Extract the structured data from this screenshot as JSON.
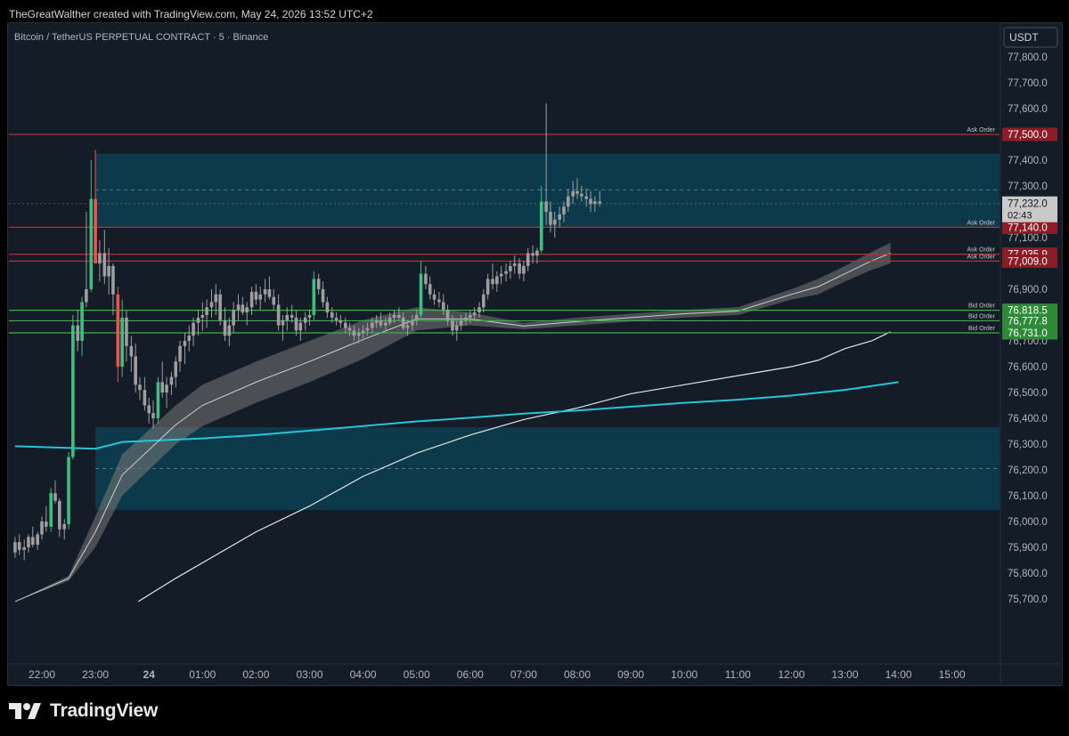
{
  "header": {
    "attribution": "TheGreatWalther created with TradingView.com, May 24, 2026 13:52 UTC+2"
  },
  "chart": {
    "title": "Bitcoin / TetherUS PERPETUAL CONTRACT · 5 · Binance",
    "currency_label": "USDT",
    "countdown": "02:43"
  },
  "branding": {
    "logo_text": "TradingView"
  },
  "colors": {
    "background": "#131c27",
    "up_candle": "#26a69a",
    "down_candle": "#ef5350",
    "neutral_candle": "#9e9e9e",
    "ask_line": "#b2303b",
    "bid_line": "#3fae4a",
    "zone_fill": "#0d3a4a",
    "ema_cyan": "#26c6da",
    "ema_white": "#e6e6e6",
    "band_fill": "#7a7a7a"
  },
  "chart_data": {
    "type": "candlestick",
    "title": "Bitcoin / TetherUS PERPETUAL CONTRACT · 5 · Binance",
    "ylim": [
      75650,
      77900
    ],
    "y_ticks": [
      "77,800.0",
      "77,700.0",
      "77,600.0",
      "77,500.0",
      "77,400.0",
      "77,300.0",
      "77,200.0",
      "77,100.0",
      "77,000.0",
      "76,900.0",
      "76,800.0",
      "76,700.0",
      "76,600.0",
      "76,500.0",
      "76,400.0",
      "76,300.0",
      "76,200.0",
      "76,100.0",
      "76,000.0",
      "75,900.0",
      "75,800.0",
      "75,700.0"
    ],
    "x_ticks": [
      "22:00",
      "23:00",
      "24",
      "01:00",
      "02:00",
      "03:00",
      "04:00",
      "05:00",
      "06:00",
      "07:00",
      "08:00",
      "09:00",
      "10:00",
      "11:00",
      "12:00",
      "13:00",
      "14:00",
      "15:00"
    ],
    "last_price": {
      "value": 77232,
      "label": "77,232.0"
    },
    "price_levels": [
      {
        "kind": "ask",
        "label": "Ask Order",
        "price": 77500,
        "price_label": "77,500.0"
      },
      {
        "kind": "ask",
        "label": "Ask Order",
        "price": 77140,
        "price_label": "77,140.0"
      },
      {
        "kind": "ask",
        "label": "Ask Order",
        "price": 77035.9,
        "price_label": "77,035.9"
      },
      {
        "kind": "ask",
        "label": "Ask Order",
        "price": 77009,
        "price_label": "77,009.0"
      },
      {
        "kind": "bid",
        "label": "Bid Order",
        "price": 76818.5,
        "price_label": "76,818.5"
      },
      {
        "kind": "bid",
        "label": "Bid Order",
        "price": 76777.8,
        "price_label": "76,777.8"
      },
      {
        "kind": "bid",
        "label": "Bid Order",
        "price": 76731.0,
        "price_label": "76,731.0"
      }
    ],
    "zones": [
      {
        "from_hour": 23.0,
        "price_top": 77425,
        "price_bottom": 77140,
        "mid": 77285
      },
      {
        "from_hour": 23.0,
        "price_top": 76365,
        "price_bottom": 76045,
        "mid": 76205
      }
    ],
    "ema_cyan": [
      [
        21.5,
        76292
      ],
      [
        23.0,
        76282
      ],
      [
        23.5,
        76308
      ],
      [
        1.0,
        76322
      ],
      [
        2.0,
        76335
      ],
      [
        3.0,
        76352
      ],
      [
        4.0,
        76370
      ],
      [
        5.0,
        76388
      ],
      [
        6.0,
        76402
      ],
      [
        7.0,
        76418
      ],
      [
        8.0,
        76430
      ],
      [
        9.0,
        76445
      ],
      [
        10.0,
        76460
      ],
      [
        11.0,
        76472
      ],
      [
        12.0,
        76488
      ],
      [
        13.0,
        76510
      ],
      [
        14.0,
        76540
      ]
    ],
    "ema_white": [
      [
        23.8,
        75690
      ],
      [
        0.5,
        75780
      ],
      [
        1.0,
        75840
      ],
      [
        2.0,
        75960
      ],
      [
        3.0,
        76060
      ],
      [
        4.0,
        76175
      ],
      [
        5.0,
        76265
      ],
      [
        6.0,
        76335
      ],
      [
        7.0,
        76395
      ],
      [
        8.0,
        76440
      ],
      [
        9.0,
        76495
      ],
      [
        10.0,
        76530
      ],
      [
        11.0,
        76565
      ],
      [
        12.0,
        76600
      ],
      [
        12.5,
        76625
      ],
      [
        13.0,
        76670
      ],
      [
        13.5,
        76700
      ],
      [
        13.85,
        76735
      ]
    ],
    "band": [
      [
        21.5,
        75690,
        75690
      ],
      [
        22.5,
        75770,
        75790
      ],
      [
        23.0,
        75900,
        76020
      ],
      [
        23.5,
        76100,
        76260
      ],
      [
        0.5,
        76300,
        76450
      ],
      [
        1.0,
        76370,
        76530
      ],
      [
        2.0,
        76460,
        76620
      ],
      [
        3.0,
        76540,
        76700
      ],
      [
        4.0,
        76630,
        76780
      ],
      [
        5.0,
        76740,
        76830
      ],
      [
        6.0,
        76760,
        76810
      ],
      [
        7.0,
        76745,
        76770
      ],
      [
        8.0,
        76760,
        76790
      ],
      [
        9.0,
        76775,
        76805
      ],
      [
        10.0,
        76790,
        76820
      ],
      [
        11.0,
        76800,
        76830
      ],
      [
        12.0,
        76860,
        76900
      ],
      [
        12.5,
        76880,
        76940
      ],
      [
        13.0,
        76930,
        76990
      ],
      [
        13.5,
        76975,
        77045
      ],
      [
        13.85,
        77000,
        77080
      ]
    ],
    "candles": [
      [
        21.5,
        75880,
        75940,
        75860,
        75920
      ],
      [
        21.58,
        75920,
        75950,
        75870,
        75890
      ],
      [
        21.67,
        75890,
        75930,
        75850,
        75900
      ],
      [
        21.75,
        75900,
        75950,
        75880,
        75940
      ],
      [
        21.83,
        75940,
        75980,
        75900,
        75910
      ],
      [
        21.92,
        75910,
        75960,
        75890,
        75950
      ],
      [
        22.0,
        75950,
        76020,
        75930,
        76000
      ],
      [
        22.08,
        76000,
        76060,
        75960,
        75980
      ],
      [
        22.17,
        75980,
        76130,
        75960,
        76110
      ],
      [
        22.25,
        76110,
        76160,
        76070,
        76080
      ],
      [
        22.33,
        76080,
        76090,
        75940,
        75970
      ],
      [
        22.42,
        75970,
        76010,
        75930,
        75990
      ],
      [
        22.5,
        75990,
        76270,
        75970,
        76250
      ],
      [
        22.58,
        76250,
        76800,
        76240,
        76760
      ],
      [
        22.67,
        76760,
        76820,
        76660,
        76700
      ],
      [
        22.75,
        76700,
        76870,
        76640,
        76850
      ],
      [
        22.83,
        76850,
        77200,
        76830,
        76900
      ],
      [
        22.92,
        76900,
        77400,
        76890,
        77250
      ],
      [
        23.0,
        77250,
        77440,
        77050,
        77000
      ],
      [
        23.08,
        77000,
        77090,
        76930,
        77040
      ],
      [
        23.17,
        77040,
        77130,
        76920,
        76950
      ],
      [
        23.25,
        76950,
        77060,
        76880,
        76990
      ],
      [
        23.33,
        76990,
        77000,
        76800,
        76880
      ],
      [
        23.42,
        76880,
        76910,
        76540,
        76600
      ],
      [
        23.5,
        76600,
        76860,
        76560,
        76790
      ],
      [
        23.58,
        76790,
        76820,
        76620,
        76680
      ],
      [
        23.67,
        76680,
        76720,
        76580,
        76640
      ],
      [
        23.75,
        76640,
        76690,
        76500,
        76530
      ],
      [
        23.83,
        76530,
        76560,
        76470,
        76510
      ],
      [
        23.92,
        76510,
        76560,
        76430,
        76450
      ],
      [
        24.0,
        76450,
        76480,
        76380,
        76420
      ],
      [
        24.08,
        76420,
        76470,
        76360,
        76400
      ],
      [
        24.17,
        76400,
        76560,
        76380,
        76540
      ],
      [
        24.25,
        76540,
        76620,
        76480,
        76500
      ],
      [
        24.33,
        76500,
        76560,
        76440,
        76530
      ],
      [
        24.42,
        76530,
        76580,
        76490,
        76560
      ],
      [
        24.5,
        76560,
        76640,
        76520,
        76620
      ],
      [
        24.58,
        76620,
        76700,
        76580,
        76680
      ],
      [
        24.67,
        76680,
        76730,
        76610,
        76700
      ],
      [
        24.75,
        76700,
        76760,
        76660,
        76720
      ],
      [
        24.83,
        76720,
        76790,
        76680,
        76770
      ],
      [
        24.92,
        76770,
        76820,
        76720,
        76790
      ],
      [
        25.0,
        76790,
        76850,
        76740,
        76800
      ],
      [
        25.08,
        76800,
        76860,
        76750,
        76830
      ],
      [
        25.17,
        76830,
        76900,
        76790,
        76850
      ],
      [
        25.25,
        76850,
        76920,
        76800,
        76880
      ],
      [
        25.33,
        76880,
        76900,
        76760,
        76780
      ],
      [
        25.42,
        76780,
        76830,
        76700,
        76720
      ],
      [
        25.5,
        76720,
        76790,
        76680,
        76760
      ],
      [
        25.58,
        76760,
        76850,
        76730,
        76820
      ],
      [
        25.67,
        76820,
        76880,
        76780,
        76840
      ],
      [
        25.75,
        76840,
        76870,
        76800,
        76810
      ],
      [
        25.83,
        76810,
        76850,
        76760,
        76830
      ],
      [
        25.92,
        76830,
        76910,
        76800,
        76890
      ],
      [
        26.0,
        76890,
        76920,
        76840,
        76860
      ],
      [
        26.08,
        76860,
        76910,
        76820,
        76880
      ],
      [
        26.17,
        76880,
        76940,
        76850,
        76900
      ],
      [
        26.25,
        76900,
        76950,
        76860,
        76870
      ],
      [
        26.33,
        76870,
        76900,
        76820,
        76840
      ],
      [
        26.42,
        76840,
        76880,
        76740,
        76760
      ],
      [
        26.5,
        76760,
        76800,
        76700,
        76780
      ],
      [
        26.58,
        76780,
        76830,
        76740,
        76800
      ],
      [
        26.67,
        76800,
        76840,
        76770,
        76790
      ],
      [
        26.75,
        76790,
        76820,
        76720,
        76740
      ],
      [
        26.83,
        76740,
        76790,
        76700,
        76770
      ],
      [
        26.92,
        76770,
        76810,
        76740,
        76790
      ],
      [
        27.0,
        76790,
        76820,
        76760,
        76800
      ],
      [
        27.08,
        76800,
        76970,
        76780,
        76940
      ],
      [
        27.17,
        76940,
        76960,
        76880,
        76900
      ],
      [
        27.25,
        76900,
        76930,
        76830,
        76850
      ],
      [
        27.33,
        76850,
        76870,
        76790,
        76810
      ],
      [
        27.42,
        76810,
        76830,
        76770,
        76790
      ],
      [
        27.5,
        76790,
        76810,
        76760,
        76780
      ],
      [
        27.58,
        76780,
        76800,
        76750,
        76770
      ],
      [
        27.67,
        76770,
        76790,
        76730,
        76750
      ],
      [
        27.75,
        76750,
        76770,
        76720,
        76740
      ],
      [
        27.83,
        76740,
        76760,
        76700,
        76720
      ],
      [
        27.92,
        76720,
        76750,
        76690,
        76730
      ],
      [
        28.0,
        76730,
        76760,
        76710,
        76740
      ],
      [
        28.08,
        76740,
        76770,
        76720,
        76750
      ],
      [
        28.17,
        76750,
        76790,
        76730,
        76770
      ],
      [
        28.25,
        76770,
        76800,
        76750,
        76780
      ],
      [
        28.33,
        76780,
        76810,
        76750,
        76760
      ],
      [
        28.42,
        76760,
        76790,
        76740,
        76770
      ],
      [
        28.5,
        76770,
        76810,
        76760,
        76790
      ],
      [
        28.58,
        76790,
        76820,
        76770,
        76800
      ],
      [
        28.67,
        76800,
        76830,
        76780,
        76790
      ],
      [
        28.75,
        76790,
        76810,
        76740,
        76750
      ],
      [
        28.83,
        76750,
        76780,
        76720,
        76760
      ],
      [
        28.92,
        76760,
        76800,
        76740,
        76780
      ],
      [
        29.0,
        76780,
        76820,
        76760,
        76800
      ],
      [
        29.08,
        76800,
        77010,
        76790,
        76960
      ],
      [
        29.17,
        76960,
        76990,
        76900,
        76920
      ],
      [
        29.25,
        76920,
        76950,
        76860,
        76880
      ],
      [
        29.33,
        76880,
        76900,
        76840,
        76860
      ],
      [
        29.42,
        76860,
        76890,
        76830,
        76850
      ],
      [
        29.5,
        76850,
        76880,
        76800,
        76820
      ],
      [
        29.58,
        76820,
        76840,
        76760,
        76780
      ],
      [
        29.67,
        76780,
        76800,
        76720,
        76740
      ],
      [
        29.75,
        76740,
        76780,
        76700,
        76760
      ],
      [
        29.83,
        76760,
        76800,
        76740,
        76780
      ],
      [
        29.92,
        76780,
        76810,
        76760,
        76790
      ],
      [
        30.0,
        76790,
        76820,
        76770,
        76800
      ],
      [
        30.08,
        76800,
        76830,
        76780,
        76810
      ],
      [
        30.17,
        76810,
        76850,
        76790,
        76830
      ],
      [
        30.25,
        76830,
        76900,
        76810,
        76880
      ],
      [
        30.33,
        76880,
        76960,
        76860,
        76940
      ],
      [
        30.42,
        76940,
        77000,
        76900,
        76920
      ],
      [
        30.5,
        76920,
        76970,
        76890,
        76950
      ],
      [
        30.58,
        76950,
        76990,
        76920,
        76960
      ],
      [
        30.67,
        76960,
        77000,
        76930,
        76970
      ],
      [
        30.75,
        76970,
        77010,
        76940,
        76990
      ],
      [
        30.83,
        76990,
        77030,
        76960,
        77000
      ],
      [
        30.92,
        77000,
        77020,
        76940,
        76960
      ],
      [
        31.0,
        76960,
        77010,
        76930,
        76990
      ],
      [
        31.08,
        76990,
        77060,
        76970,
        77040
      ],
      [
        31.17,
        77040,
        77070,
        77000,
        77030
      ],
      [
        31.25,
        77030,
        77060,
        77000,
        77050
      ],
      [
        31.33,
        77050,
        77300,
        77040,
        77240
      ],
      [
        31.42,
        77240,
        77620,
        77150,
        77200
      ],
      [
        31.5,
        77200,
        77240,
        77120,
        77150
      ],
      [
        31.58,
        77150,
        77200,
        77100,
        77170
      ],
      [
        31.67,
        77170,
        77220,
        77140,
        77190
      ],
      [
        31.75,
        77190,
        77240,
        77160,
        77220
      ],
      [
        31.83,
        77220,
        77290,
        77200,
        77260
      ],
      [
        31.92,
        77260,
        77320,
        77230,
        77280
      ],
      [
        32.0,
        77280,
        77330,
        77250,
        77270
      ],
      [
        32.08,
        77270,
        77300,
        77240,
        77260
      ],
      [
        32.17,
        77260,
        77290,
        77220,
        77250
      ],
      [
        32.25,
        77250,
        77280,
        77200,
        77230
      ],
      [
        32.33,
        77230,
        77260,
        77200,
        77240
      ],
      [
        32.42,
        77240,
        77280,
        77220,
        77232
      ]
    ]
  }
}
